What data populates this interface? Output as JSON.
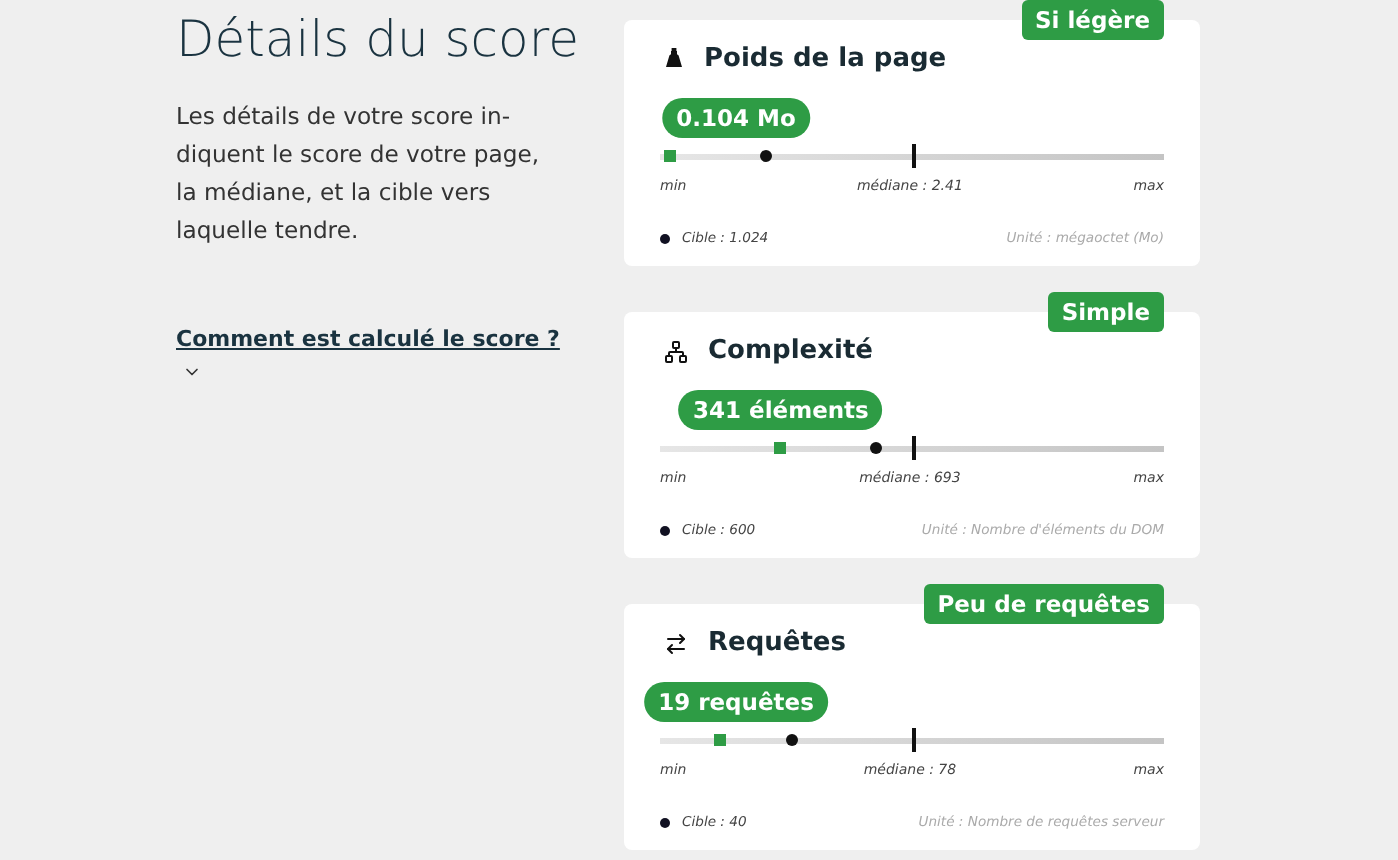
{
  "heading": "Détails du score",
  "intro": "Les détails de votre score in-diquent le score de votre page, la médiane, et la cible vers laquelle tendre.",
  "help_link": {
    "label": "Comment est calculé le score ?",
    "expanded": false
  },
  "cards": [
    {
      "kind": "weight",
      "title": "Poids de la page",
      "badge": "Si légère",
      "score": {
        "label": "0.104 Mo",
        "level": 0.02
      },
      "target_marker": {
        "level": 0.21
      },
      "median_tick": {
        "level": 0.5
      },
      "min": "min",
      "median": "médiane : 2.41",
      "max": "max",
      "target": "Cible : 1.024",
      "unit": "Unité : mégaoctet (Mo)"
    },
    {
      "kind": "sitemap",
      "title": "Complexité",
      "badge": "Simple",
      "score": {
        "label": "341 éléments",
        "level": 0.24
      },
      "target_marker": {
        "level": 0.43
      },
      "median_tick": {
        "level": 0.5
      },
      "min": "min",
      "median": "médiane : 693",
      "max": "max",
      "target": "Cible : 600",
      "unit": "Unité : Nombre d'éléments du DOM"
    },
    {
      "kind": "swap",
      "title": "Requêtes",
      "badge": "Peu de requêtes",
      "score": {
        "label": "19 requêtes",
        "level": 0.12
      },
      "target_marker": {
        "level": 0.26
      },
      "median_tick": {
        "level": 0.5
      },
      "min": "min",
      "median": "médiane : 78",
      "max": "max",
      "target": "Cible : 40",
      "unit": "Unité : Nombre de requêtes serveur"
    }
  ]
}
